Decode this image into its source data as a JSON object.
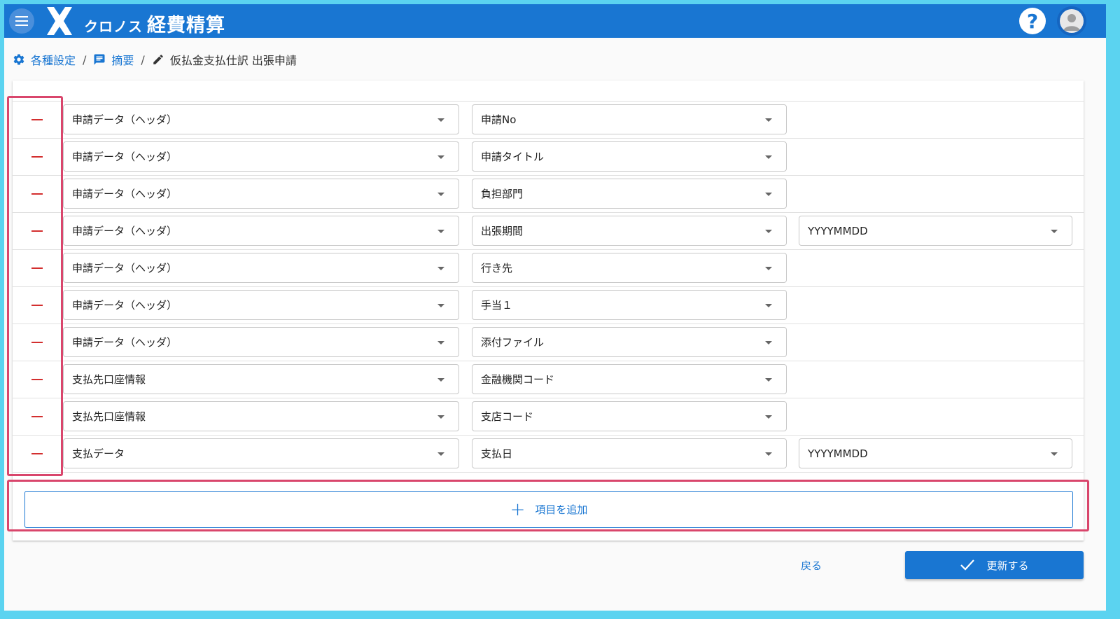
{
  "header": {
    "brand": "クロノス",
    "product": "経費精算",
    "menu_icon": "menu-icon",
    "help_icon": "help-icon",
    "avatar_icon": "account-icon"
  },
  "breadcrumb": [
    {
      "label": "各種設定",
      "icon": "gear-icon"
    },
    {
      "label": "摘要",
      "icon": "comment-icon"
    },
    {
      "label": "仮払金支払仕訳 出張申請",
      "icon": "pencil-icon"
    }
  ],
  "breadcrumb_separator": "/",
  "rows": [
    {
      "category": "申請データ（ヘッダ）",
      "field": "申請No",
      "format": ""
    },
    {
      "category": "申請データ（ヘッダ）",
      "field": "申請タイトル",
      "format": ""
    },
    {
      "category": "申請データ（ヘッダ）",
      "field": "負担部門",
      "format": ""
    },
    {
      "category": "申請データ（ヘッダ）",
      "field": "出張期間",
      "format": "YYYYMMDD"
    },
    {
      "category": "申請データ（ヘッダ）",
      "field": "行き先",
      "format": ""
    },
    {
      "category": "申請データ（ヘッダ）",
      "field": "手当１",
      "format": ""
    },
    {
      "category": "申請データ（ヘッダ）",
      "field": "添付ファイル",
      "format": ""
    },
    {
      "category": "支払先口座情報",
      "field": "金融機関コード",
      "format": ""
    },
    {
      "category": "支払先口座情報",
      "field": "支店コード",
      "format": ""
    },
    {
      "category": "支払データ",
      "field": "支払日",
      "format": "YYYYMMDD"
    }
  ],
  "add_item_label": "項目を追加",
  "back_label": "戻る",
  "update_label": "更新する",
  "colors": {
    "appbar": "#1976d2",
    "accent": "#1976d2",
    "remove": "#d32f2f",
    "highlight": "#d9466c",
    "frame": "#5bd3f0"
  }
}
